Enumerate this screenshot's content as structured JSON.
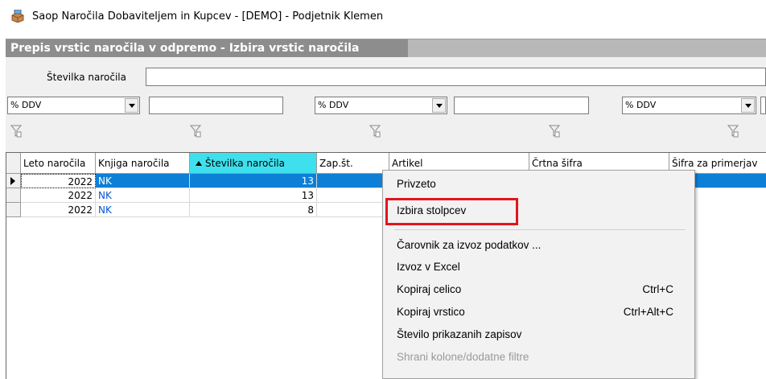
{
  "window": {
    "title": "Saop Naročila Dobaviteljem in Kupcev -  [DEMO] - Podjetnik Klemen",
    "icon": "app-boxes-icon"
  },
  "form": {
    "header": "Prepis vrstic naročila v odpremo - Izbira vrstic naročila"
  },
  "filters": {
    "order_number_label": "Številka naročila",
    "order_number_value": "",
    "combos": [
      {
        "value": "% DDV"
      },
      {
        "value": "% DDV"
      },
      {
        "value": "% DDV"
      }
    ]
  },
  "grid": {
    "columns": [
      "Leto naročila",
      "Knjiga naročila",
      "Številka naročila",
      "Zap.št.",
      "Artikel",
      "Črtna šifra",
      "Šifra za primerjav"
    ],
    "sorted_column": "Številka naročila",
    "rows": [
      {
        "year": "2022",
        "book": "NK",
        "number": "13",
        "selected": true
      },
      {
        "year": "2022",
        "book": "NK",
        "number": "13",
        "selected": false
      },
      {
        "year": "2022",
        "book": "NK",
        "number": "8",
        "selected": false
      }
    ]
  },
  "context_menu": {
    "items": [
      {
        "label": "Privzeto",
        "shortcut": ""
      },
      {
        "label": "Izbira stolpcev",
        "shortcut": ""
      },
      {
        "label": "Čarovnik za izvoz podatkov ...",
        "shortcut": ""
      },
      {
        "label": "Izvoz v Excel",
        "shortcut": ""
      },
      {
        "label": "Kopiraj celico",
        "shortcut": "Ctrl+C"
      },
      {
        "label": "Kopiraj vrstico",
        "shortcut": "Ctrl+Alt+C"
      },
      {
        "label": "Število prikazanih zapisov",
        "shortcut": ""
      },
      {
        "label": "Shrani kolone/dodatne filtre",
        "shortcut": "",
        "disabled": true
      }
    ],
    "highlighted_item": "Izbira stolpcev",
    "highlight_color": "#e3141e"
  },
  "colors": {
    "selection": "#0d7fd6",
    "sorted_header": "#3fe0ee",
    "header_band": "#8d8d8d"
  }
}
